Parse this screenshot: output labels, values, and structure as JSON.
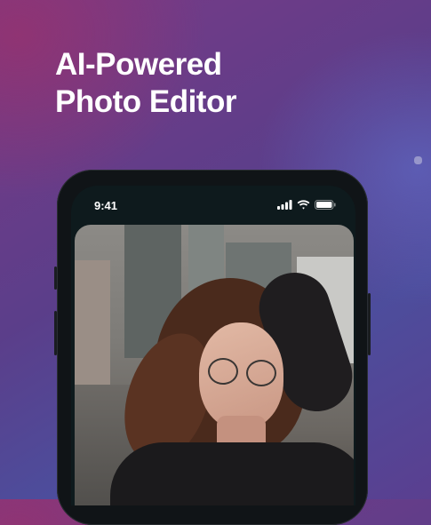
{
  "headline": {
    "line1": "AI-Powered",
    "line2": "Photo Editor"
  },
  "phone": {
    "status_bar": {
      "time": "9:41",
      "icons": [
        "cellular-signal-icon",
        "wifi-icon",
        "battery-icon"
      ]
    },
    "photo": {
      "subject": "portrait-photo"
    }
  },
  "colors": {
    "background_primary": "#5b3e8a",
    "background_accent": "#7a3a86",
    "headline_text": "#ffffff",
    "phone_frame": "#101417"
  }
}
